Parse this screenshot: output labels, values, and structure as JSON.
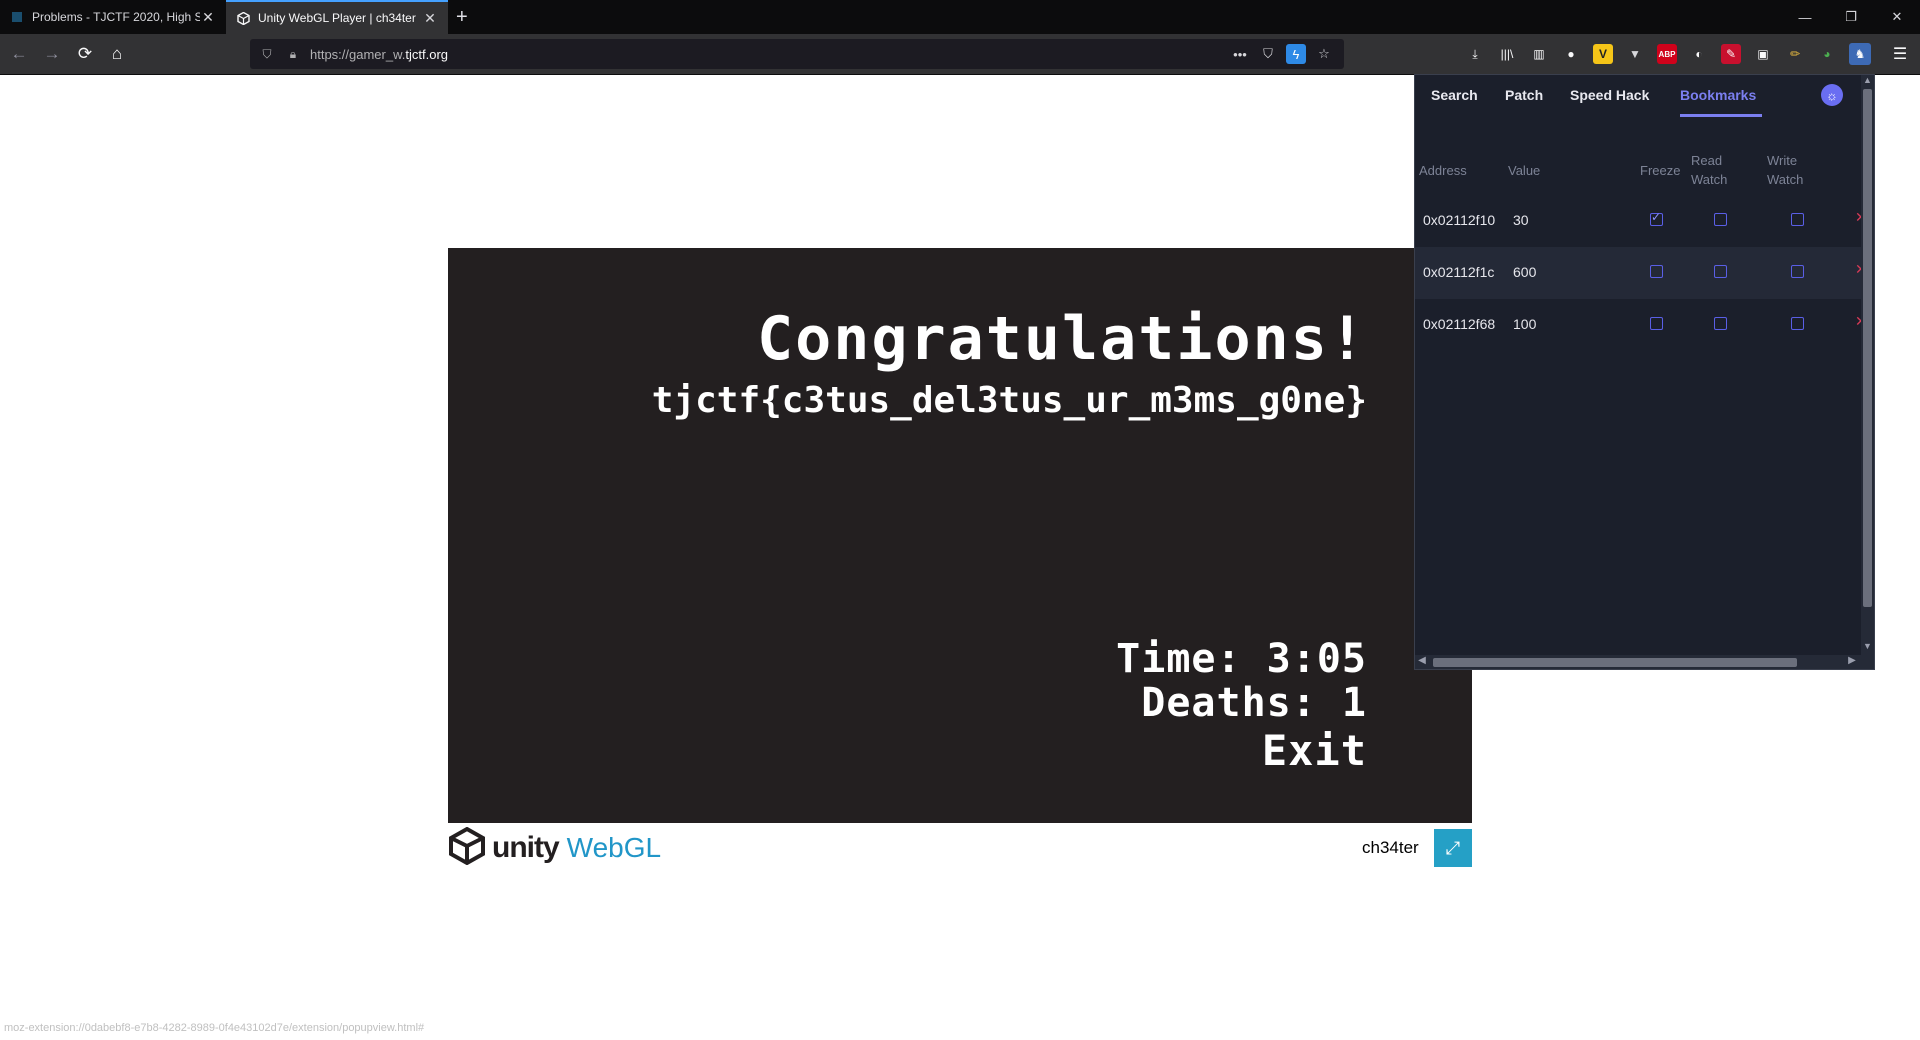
{
  "browser": {
    "tabs": [
      {
        "title": "Problems - TJCTF 2020, High Sc",
        "active": false
      },
      {
        "title": "Unity WebGL Player | ch34ter",
        "active": true
      }
    ],
    "url_prefix": "https://gamer_w.",
    "url_domain": "tjctf.org",
    "toolbar_icons": [
      "download-icon",
      "library-icon",
      "sidebar-icon",
      "account-icon",
      "extension-v-icon",
      "vue-devtools-icon",
      "adblock-icon",
      "extension-icon",
      "extension-red-icon",
      "extension-glasses-icon",
      "extension-pencil-icon",
      "extension-green-icon",
      "cheat-extension-icon",
      "menu-icon"
    ],
    "adblock_label": "ABP"
  },
  "game": {
    "title": "Congratulations!",
    "flag": "tjctf{c3tus_del3tus_ur_m3ms_g0ne}",
    "time": "Time: 3:05",
    "deaths": "Deaths: 1",
    "exit": "Exit"
  },
  "footer": {
    "logo_unity": "unity",
    "logo_webgl": "WebGL",
    "title": "ch34ter"
  },
  "extension": {
    "tabs": [
      "Search",
      "Patch",
      "Speed Hack",
      "Bookmarks"
    ],
    "active_tab": "Bookmarks",
    "columns": {
      "address": "Address",
      "value": "Value",
      "freeze": "Freeze",
      "read_watch_1": "Read",
      "read_watch_2": "Watch",
      "write_watch_1": "Write",
      "write_watch_2": "Watch"
    },
    "rows": [
      {
        "address": "0x02112f10",
        "value": "30",
        "freeze": true,
        "read_watch": false,
        "write_watch": false
      },
      {
        "address": "0x02112f1c",
        "value": "600",
        "freeze": false,
        "read_watch": false,
        "write_watch": false
      },
      {
        "address": "0x02112f68",
        "value": "100",
        "freeze": false,
        "read_watch": false,
        "write_watch": false
      }
    ]
  },
  "status_bar": "moz-extension://0dabebf8-e7b8-4282-8989-0f4e43102d7e/extension/popupview.html#"
}
